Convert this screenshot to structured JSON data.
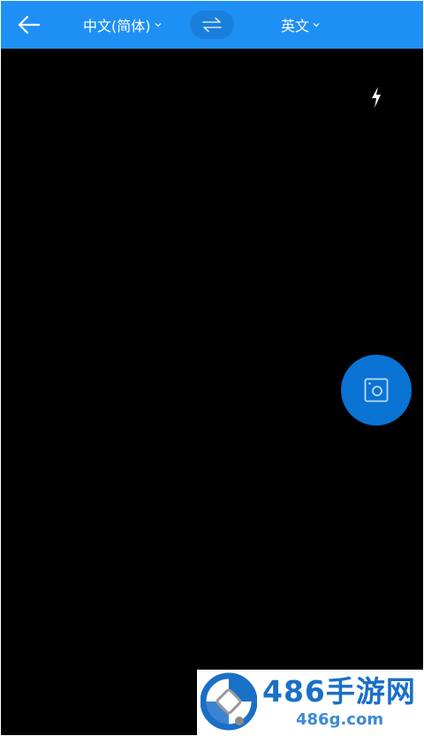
{
  "header": {
    "back_icon": "arrow-left-icon",
    "source_language": "中文(简体)",
    "target_language": "英文",
    "swap_icon": "swap-arrows-icon",
    "chevron_icon": "chevron-down-icon",
    "bar_color": "#1e90f5"
  },
  "camera": {
    "flash_icon": "flash-icon",
    "capture_icon": "camera-capture-icon",
    "capture_color": "#0a73d4",
    "viewfinder_color": "#000000"
  },
  "watermark": {
    "name": "486手游网",
    "url": "486g.com"
  }
}
